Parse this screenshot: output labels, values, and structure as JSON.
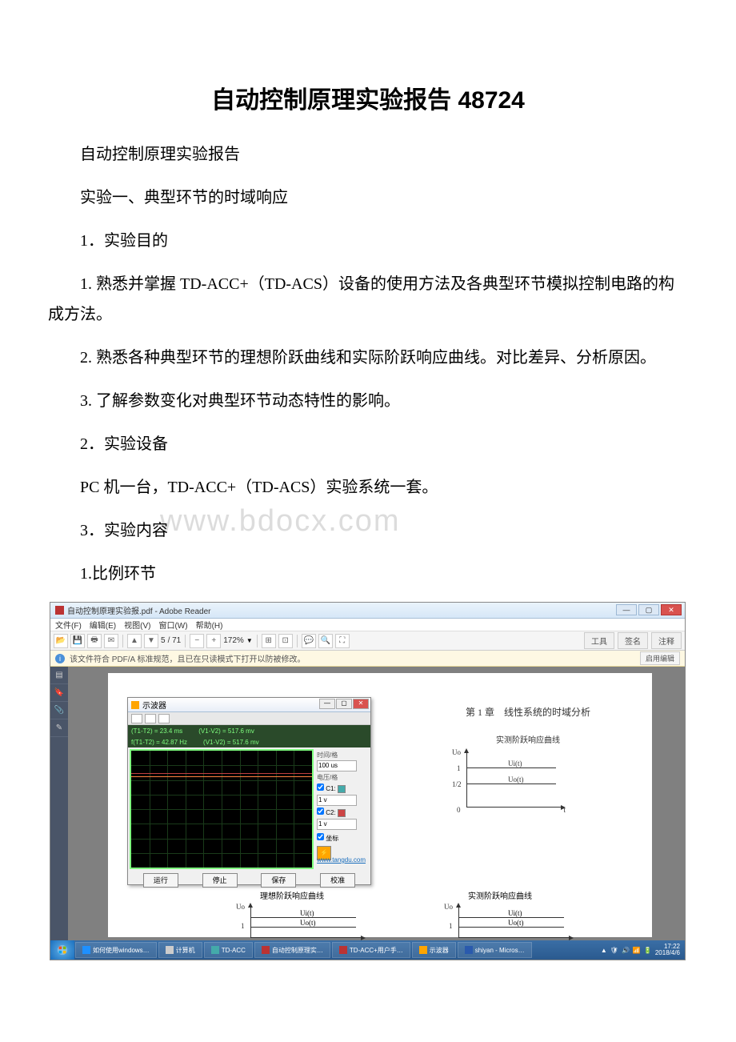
{
  "title": "自动控制原理实验报告 48724",
  "paragraphs": {
    "p1": "自动控制原理实验报告",
    "p2": "实验一、典型环节的时域响应",
    "p3": "1．实验目的",
    "p4": "1. 熟悉并掌握 TD-ACC+（TD-ACS）设备的使用方法及各典型环节模拟控制电路的构成方法。",
    "p5": "2. 熟悉各种典型环节的理想阶跃曲线和实际阶跃响应曲线。对比差异、分析原因。",
    "p6": "3. 了解参数变化对典型环节动态特性的影响。",
    "p7": "2．实验设备",
    "p8": "PC 机一台，TD-ACC+（TD-ACS）实验系统一套。",
    "p9": "3．实验内容",
    "p10": "1.比例环节"
  },
  "watermark": "www.bdocx.com",
  "screenshot": {
    "app_title": "自动控制原理实验报.pdf - Adobe Reader",
    "menu": {
      "file": "文件(F)",
      "edit": "编辑(E)",
      "view": "视图(V)",
      "window": "窗口(W)",
      "help": "帮助(H)"
    },
    "toolbar": {
      "page_current": "5",
      "page_total": "/ 71",
      "zoom": "172%",
      "tools": "工具",
      "sign": "签名",
      "comment": "注释"
    },
    "notice": {
      "text": "该文件符合 PDF/A 标准规范，且已在只读模式下打开以防被修改。",
      "apply": "启用编辑"
    },
    "scope": {
      "title": "示波器",
      "info1": "(T1-T2) = 23.4 ms",
      "info2": "f(T1-T2) = 42.87 Hz",
      "info3": "(V1-V2) = 517.6 mv",
      "info4": "(V1-V2) = 517.6 mv",
      "time_label": "时间/格",
      "time_val": "100 us",
      "volt_label": "电压/格",
      "v1": "1 v",
      "v2": "1 v",
      "coord": "坐标",
      "btn_run": "运行",
      "btn_stop": "停止",
      "btn_save": "保存",
      "btn_cfg": "校准",
      "link": "www.tangdu.com"
    },
    "pdf_content": {
      "chapter": "第 1 章　线性系统的时域分析",
      "plot1_title": "实测阶跃响应曲线",
      "plot2_title": "理想阶跃响应曲线",
      "plot3_title": "实测阶跃响应曲线",
      "uo": "Uo",
      "ui": "Ui(t)",
      "uot": "Uo(t)",
      "t": "t",
      "tick1": "1",
      "tick12": "1/2",
      "tick0": "0"
    },
    "taskbar": {
      "t1": "如何使用windows…",
      "t2": "计算机",
      "t3": "TD-ACC",
      "t4": "自动控制原理实…",
      "t5": "TD-ACC+用户手…",
      "t6": "示波器",
      "t7": "shiyan - Micros…",
      "time": "17:22",
      "date": "2018/4/6"
    }
  }
}
